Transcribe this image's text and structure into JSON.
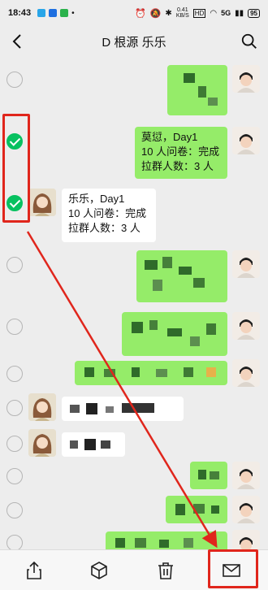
{
  "status": {
    "time": "18:43",
    "speed_value": "0.41",
    "speed_unit": "KB/S",
    "network": "5G",
    "battery": "95"
  },
  "header": {
    "title": "D 根源 乐乐",
    "back_icon": "chevron-left-icon",
    "search_icon": "search-icon"
  },
  "messages": [
    {
      "from": "me",
      "selected": false,
      "lines": []
    },
    {
      "from": "me",
      "selected": true,
      "lines": [
        "莫愆，Day1",
        "10 人问卷：完成",
        "拉群人数：3 人"
      ]
    },
    {
      "from": "her",
      "selected": true,
      "lines": [
        "乐乐，Day1",
        "10 人问卷：完成",
        "拉群人数：3 人"
      ]
    },
    {
      "from": "me",
      "selected": false,
      "lines": []
    },
    {
      "from": "me",
      "selected": false,
      "lines": []
    },
    {
      "from": "me",
      "selected": false,
      "lines": []
    },
    {
      "from": "her",
      "selected": false,
      "lines": []
    },
    {
      "from": "her",
      "selected": false,
      "lines": []
    },
    {
      "from": "me",
      "selected": false,
      "lines": []
    },
    {
      "from": "me",
      "selected": false,
      "lines": []
    },
    {
      "from": "me",
      "selected": false,
      "lines": []
    }
  ],
  "toolbar": {
    "items": [
      {
        "name": "share",
        "icon": "share-icon"
      },
      {
        "name": "favorite",
        "icon": "cube-icon"
      },
      {
        "name": "delete",
        "icon": "trash-icon"
      },
      {
        "name": "email",
        "icon": "mail-icon"
      }
    ]
  },
  "annotation_color": "#e0261c",
  "accent_green": "#07c160",
  "bubble_green": "#95ec69"
}
